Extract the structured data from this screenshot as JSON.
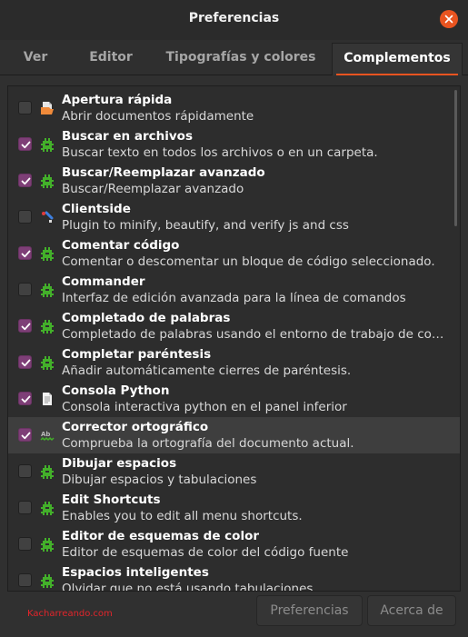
{
  "window": {
    "title": "Preferencias"
  },
  "tabs": [
    {
      "label": "Ver",
      "active": false
    },
    {
      "label": "Editor",
      "active": false
    },
    {
      "label": "Tipografías y colores",
      "active": false
    },
    {
      "label": "Complementos",
      "active": true
    }
  ],
  "plugins": [
    {
      "name": "Apertura rápida",
      "description": "Abrir documentos rápidamente",
      "enabled": false,
      "icon": "open-folder-icon",
      "selected": false
    },
    {
      "name": "Buscar en archivos",
      "description": "Buscar texto en todos los archivos o en un carpeta.",
      "enabled": true,
      "icon": "plugin-puzzle-icon",
      "selected": false
    },
    {
      "name": "Buscar/Reemplazar avanzado",
      "description": "Buscar/Reemplazar avanzado",
      "enabled": true,
      "icon": "plugin-puzzle-icon",
      "selected": false
    },
    {
      "name": "Clientside",
      "description": "Plugin to minify, beautify, and verify js and css",
      "enabled": false,
      "icon": "clientside-icon",
      "selected": false
    },
    {
      "name": "Comentar código",
      "description": "Comentar o descomentar un bloque de código seleccionado.",
      "enabled": true,
      "icon": "plugin-puzzle-icon",
      "selected": false
    },
    {
      "name": "Commander",
      "description": "Interfaz de edición avanzada para la línea de comandos",
      "enabled": false,
      "icon": "plugin-puzzle-icon",
      "selected": false
    },
    {
      "name": "Completado de palabras",
      "description": "Completado de palabras usando el entorno de trabajo de completado",
      "enabled": true,
      "icon": "plugin-puzzle-icon",
      "selected": false
    },
    {
      "name": "Completar paréntesis",
      "description": "Añadir automáticamente cierres de paréntesis.",
      "enabled": true,
      "icon": "plugin-puzzle-icon",
      "selected": false
    },
    {
      "name": "Consola Python",
      "description": "Consola interactiva python en el panel inferior",
      "enabled": true,
      "icon": "document-icon",
      "selected": false
    },
    {
      "name": "Corrector ortográfico",
      "description": "Comprueba la ortografía del documento actual.",
      "enabled": true,
      "icon": "spellcheck-icon",
      "selected": true
    },
    {
      "name": "Dibujar espacios",
      "description": "Dibujar espacios y tabulaciones",
      "enabled": false,
      "icon": "plugin-puzzle-icon",
      "selected": false
    },
    {
      "name": "Edit Shortcuts",
      "description": "Enables you to edit all menu shortcuts.",
      "enabled": false,
      "icon": "plugin-puzzle-icon",
      "selected": false
    },
    {
      "name": "Editor de esquemas de color",
      "description": "Editor de esquemas de color del código fuente",
      "enabled": false,
      "icon": "plugin-puzzle-icon",
      "selected": false
    },
    {
      "name": "Espacios inteligentes",
      "description": "Olvidar que no está usando tabulaciones.",
      "enabled": false,
      "icon": "plugin-puzzle-icon",
      "selected": false
    }
  ],
  "footer": {
    "watermark": "Kacharreando.com",
    "preferences_label": "Preferencias",
    "about_label": "Acerca de"
  },
  "colors": {
    "accent": "#e95420",
    "checkbox_checked": "#7e3f77",
    "plugin_icon": "#43b02a",
    "watermark": "#e2252b"
  }
}
